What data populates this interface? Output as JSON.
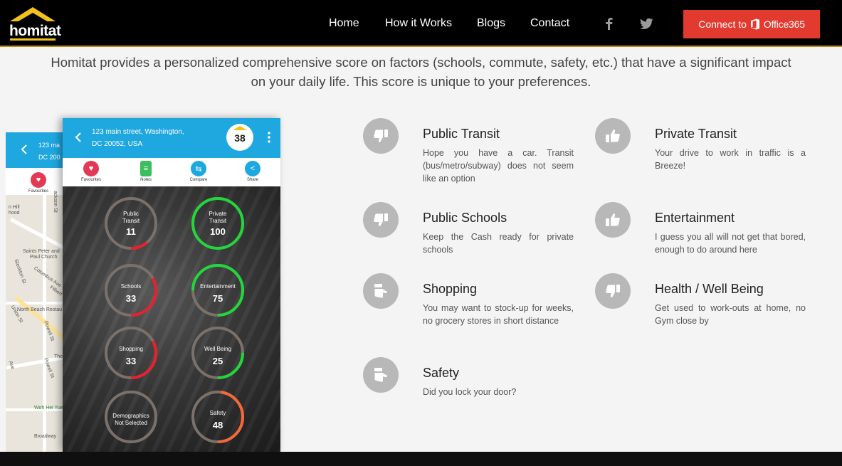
{
  "brand": {
    "name": "homitat",
    "accent": "#f3c11b"
  },
  "nav": {
    "items": [
      "Home",
      "How it Works",
      "Blogs",
      "Contact"
    ],
    "social": [
      "facebook-icon",
      "twitter-icon"
    ],
    "connect": {
      "prefix": "Connect to",
      "office": "Office365",
      "color": "#e23a2e"
    }
  },
  "intro": {
    "text": "Homitat provides a personalized comprehensive score on factors (schools, commute, safety, etc.) that have a significant impact on your daily life. This score is unique to your preferences."
  },
  "phone_back": {
    "address": [
      "123 ma",
      "DC 200"
    ],
    "tab": "Favourites",
    "map_labels": [
      "n Hill",
      "hood",
      "ackson St",
      "Saints Peter and",
      "Paul Church",
      "Stockton St",
      "Columbus Ave",
      "Filbert St",
      "Union St",
      "North Beach Restau",
      "Powell St",
      "Powell St",
      "The",
      "Woh Hei Yuen",
      "Broadway",
      "Ave"
    ]
  },
  "phone_front": {
    "address_line1": "123 main street, Washington,",
    "address_line2": "DC 20052, USA",
    "score": "38",
    "tabs": [
      {
        "label": "Favourites",
        "icon": "heart-icon",
        "color": "#e23a55"
      },
      {
        "label": "Notes",
        "icon": "notes-icon",
        "color": "#3bbf5c"
      },
      {
        "label": "Compare",
        "icon": "compare-icon",
        "color": "#1fa7e0"
      },
      {
        "label": "Share",
        "icon": "share-icon",
        "color": "#1fa7e0"
      }
    ],
    "gauges": [
      {
        "label": [
          "Public",
          "Transit"
        ],
        "value": "11",
        "fill": 0.11,
        "color": "#e8202f"
      },
      {
        "label": [
          "Private",
          "Transit"
        ],
        "value": "100",
        "fill": 1.0,
        "color": "#22d63c"
      },
      {
        "label": [
          "Schools"
        ],
        "value": "33",
        "fill": 0.33,
        "color": "#e8202f"
      },
      {
        "label": [
          "Entertainment"
        ],
        "value": "75",
        "fill": 0.75,
        "color": "#22d63c"
      },
      {
        "label": [
          "Shopping"
        ],
        "value": "33",
        "fill": 0.33,
        "color": "#e8202f"
      },
      {
        "label": [
          "Well Being"
        ],
        "value": "25",
        "fill": 0.25,
        "color": "#22d63c"
      },
      {
        "label": [
          "Demographics",
          "Not Selected"
        ],
        "value": "",
        "fill": 0,
        "color": "#888888"
      },
      {
        "label": [
          "Safety"
        ],
        "value": "48",
        "fill": 0.48,
        "color": "#f4683a"
      }
    ]
  },
  "features": [
    {
      "title": "Public Transit",
      "desc": "Hope you have a car. Transit (bus/metro/subway) does not seem like an option",
      "icon": "thumbs-down-icon"
    },
    {
      "title": "Private Transit",
      "desc": "Your drive to work in traffic is a Breeze!",
      "icon": "thumbs-up-icon"
    },
    {
      "title": "Public Schools",
      "desc": "Keep the Cash ready for private schools",
      "icon": "thumbs-down-icon"
    },
    {
      "title": "Entertainment",
      "desc": "I guess you all will not get that bored, enough to do around here",
      "icon": "thumbs-up-icon"
    },
    {
      "title": "Shopping",
      "desc": "You may want to stock-up for weeks, no grocery stores in short distance",
      "icon": "thumbs-sideways-icon"
    },
    {
      "title": "Health / Well Being",
      "desc": "Get used to work-outs at home, no Gym close by",
      "icon": "thumbs-down-icon"
    },
    {
      "title": "Safety",
      "desc": "Did you lock your door?",
      "icon": "thumbs-sideways-icon"
    }
  ]
}
